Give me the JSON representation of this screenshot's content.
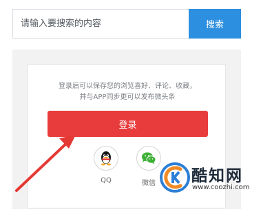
{
  "search": {
    "placeholder": "请输入要搜索的内容",
    "button_label": "搜索"
  },
  "login": {
    "prompt_line1": "登录后可以保存您的浏览喜好、评论、收藏，",
    "prompt_line2": "并与APP同步更可以发布微头条",
    "button_label": "登录"
  },
  "social": [
    {
      "label": "QQ",
      "icon": "qq-penguin-icon"
    },
    {
      "label": "微信",
      "icon": "wechat-icon"
    }
  ],
  "watermark": {
    "brand": "酷知网",
    "url": "www.coozhi.com"
  },
  "colors": {
    "search_button": "#2d8fdf",
    "login_button": "#e83c3c",
    "arrow": "#e53935",
    "wechat": "#3cb034"
  }
}
